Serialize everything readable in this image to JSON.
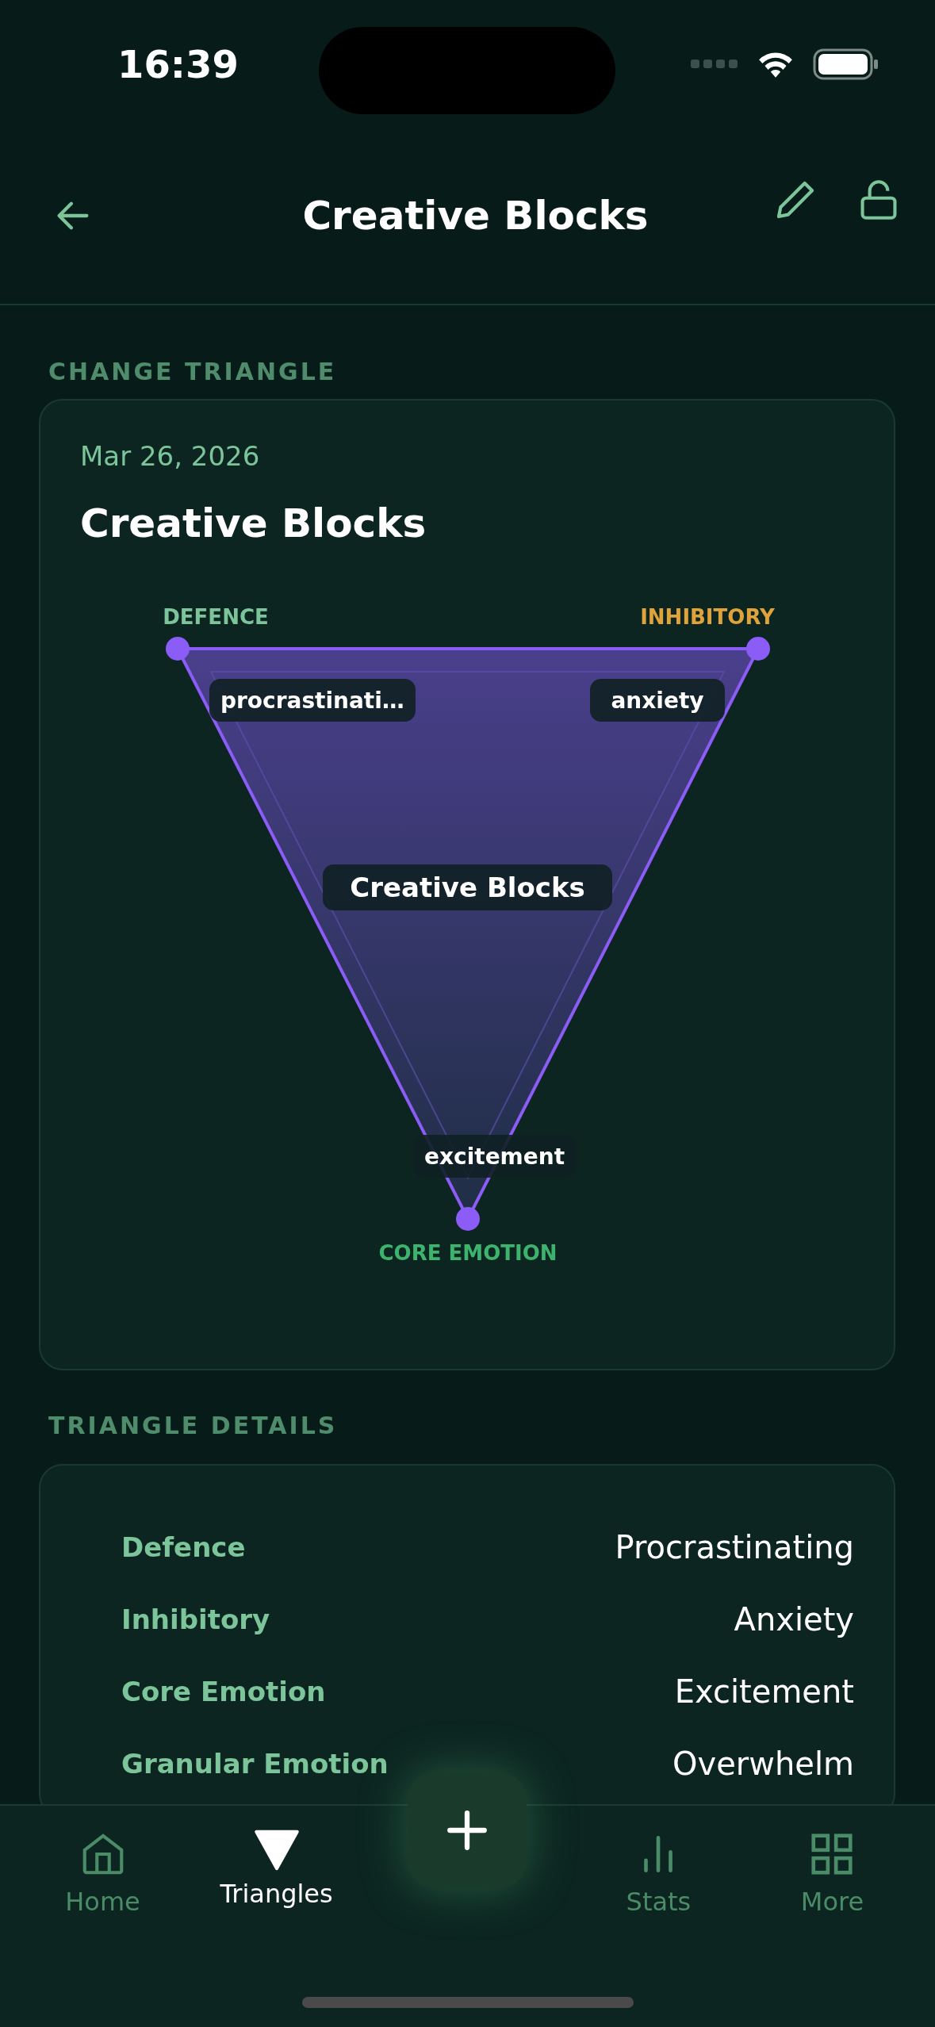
{
  "status_bar": {
    "time": "16:39"
  },
  "header": {
    "title": "Creative Blocks"
  },
  "triangle_section": {
    "heading": "CHANGE TRIANGLE",
    "date": "Mar 26, 2026",
    "title": "Creative Blocks",
    "center_label": "Creative Blocks",
    "vertices": [
      {
        "label": "DEFENCE",
        "value": "procrastinati…",
        "color": "#7cc59a"
      },
      {
        "label": "INHIBITORY",
        "value": "anxiety",
        "color": "#e0a23a"
      },
      {
        "label": "CORE EMOTION",
        "value": "excitement",
        "color": "#3cb46e"
      }
    ]
  },
  "details_section": {
    "heading": "TRIANGLE DETAILS",
    "rows": [
      {
        "label": "Defence",
        "value": "Procrastinating"
      },
      {
        "label": "Inhibitory",
        "value": "Anxiety"
      },
      {
        "label": "Core Emotion",
        "value": "Excitement"
      },
      {
        "label": "Granular Emotion",
        "value": "Overwhelm"
      }
    ]
  },
  "tab_bar": {
    "tabs": [
      {
        "label": "Home",
        "selected": false
      },
      {
        "label": "Triangles",
        "selected": true
      },
      {
        "label": "Stats",
        "selected": false
      },
      {
        "label": "More",
        "selected": false
      }
    ]
  }
}
